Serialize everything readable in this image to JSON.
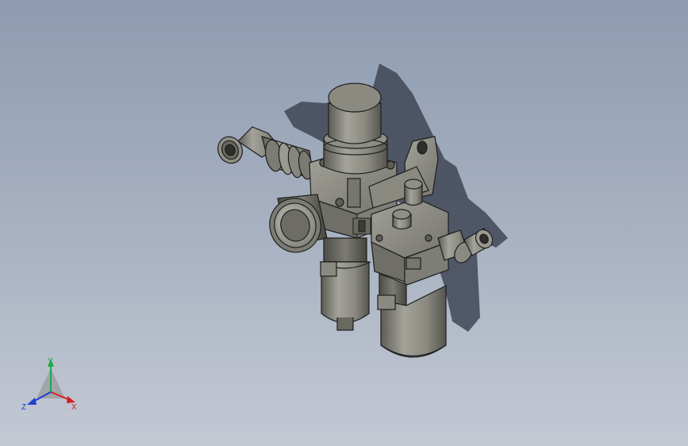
{
  "view": {
    "background_top": "#8e9bb0",
    "background_bottom": "#c3c9d3",
    "part_color": "#8f8f85",
    "part_edge_color": "#1e1e1e",
    "shadow_color": "#3f4656"
  },
  "triad": {
    "x_label": "X",
    "y_label": "Y",
    "z_label": "Z",
    "x_color": "#d42020",
    "y_color": "#1fa84a",
    "z_color": "#2040d0"
  }
}
